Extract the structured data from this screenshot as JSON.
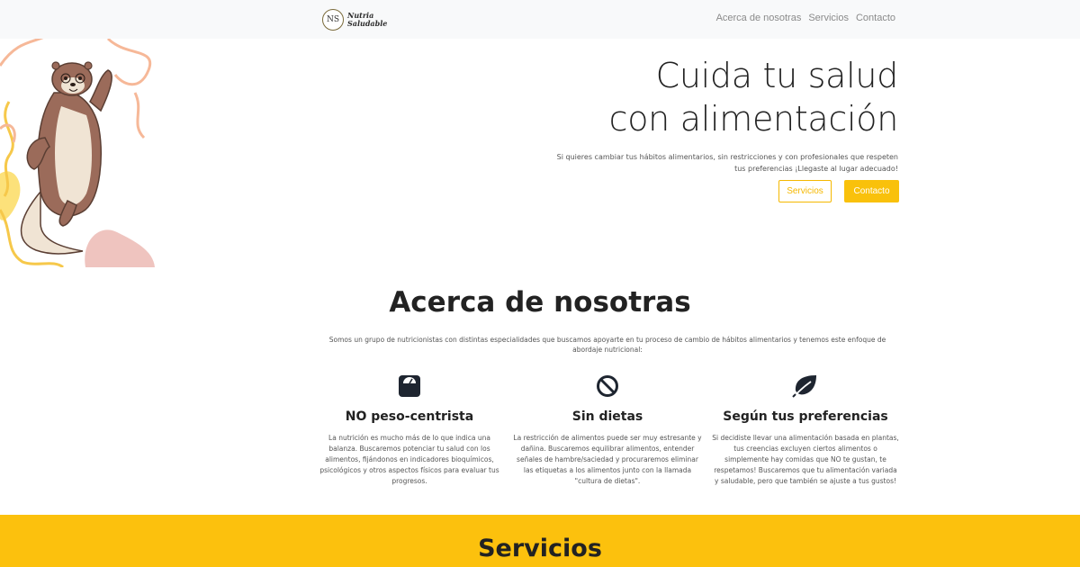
{
  "brand": {
    "initials": "NS",
    "name_line1": "Nutria",
    "name_line2": "Saludable"
  },
  "nav": {
    "links": [
      "Acerca de nosotras",
      "Servicios",
      "Contacto"
    ]
  },
  "hero": {
    "title_line1": "Cuida tu salud",
    "title_line2": "con alimentación",
    "text": "Si quieres cambiar tus hábitos alimentarios, sin restricciones y con profesionales que respeten tus preferencias ¡Llegaste al lugar adecuado!",
    "button_services": "Servicios",
    "button_contact": "Contacto"
  },
  "about": {
    "title": "Acerca de nosotras",
    "text": "Somos un grupo de nutricionistas con distintas especialidades que buscamos apoyarte en tu proceso de cambio de hábitos alimentarios y tenemos este enfoque de abordaje nutricional:",
    "features": [
      {
        "icon": "weight-scale-icon",
        "title": "NO peso-centrista",
        "text": "La nutrición es mucho más de lo que indica una balanza. Buscaremos potenciar tu salud con los alimentos, fijándonos en indicadores bioquímicos, psicológicos y otros aspectos físicos para evaluar tus progresos."
      },
      {
        "icon": "ban-icon",
        "title": "Sin dietas",
        "text": "La restricción de alimentos puede ser muy estresante y dañina. Buscaremos equilibrar alimentos, entender señales de hambre/saciedad y procuraremos eliminar las etiquetas a los alimentos junto con la llamada \"cultura de dietas\"."
      },
      {
        "icon": "leaf-icon",
        "title": "Según tus preferencias",
        "text": "Si decidiste llevar una alimentación basada en plantas, tus creencias excluyen ciertos alimentos o simplemente hay comidas que NO te gustan, te respetamos! Buscaremos que tu alimentación variada y saludable, pero que también se ajuste a tus gustos!"
      }
    ]
  },
  "services": {
    "title": "Servicios"
  },
  "colors": {
    "accent": "#fcc10d",
    "navbar_bg": "#f8f9fa"
  }
}
